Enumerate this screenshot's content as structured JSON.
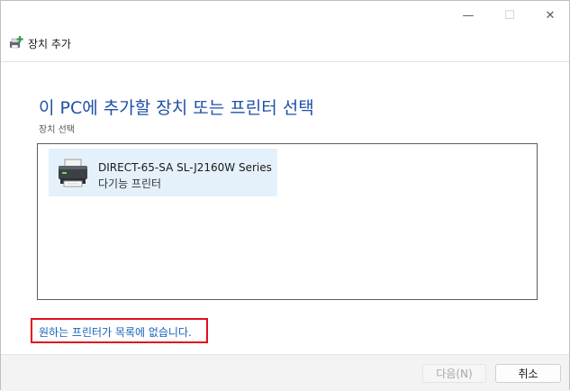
{
  "window": {
    "controls": {
      "minimize_glyph": "—",
      "maximize_glyph": "☐",
      "close_glyph": "✕"
    }
  },
  "header": {
    "icon": "add-printer-icon",
    "title": "장치 추가"
  },
  "main": {
    "title": "이 PC에 추가할 장치 또는 프린터 선택",
    "subtitle": "장치 선택",
    "devices": [
      {
        "icon": "printer-icon",
        "name": "DIRECT-65-SA SL-J2160W Series",
        "type": "다기능 프린터"
      }
    ],
    "missing_link": "원하는 프린터가 목록에 없습니다."
  },
  "footer": {
    "next_label": "다음(N)",
    "cancel_label": "취소"
  },
  "colors": {
    "title_blue": "#1e4fa8",
    "link_blue": "#1463b8",
    "highlight_red": "#e0101a",
    "selected_item_bg": "#e4f1fb"
  }
}
